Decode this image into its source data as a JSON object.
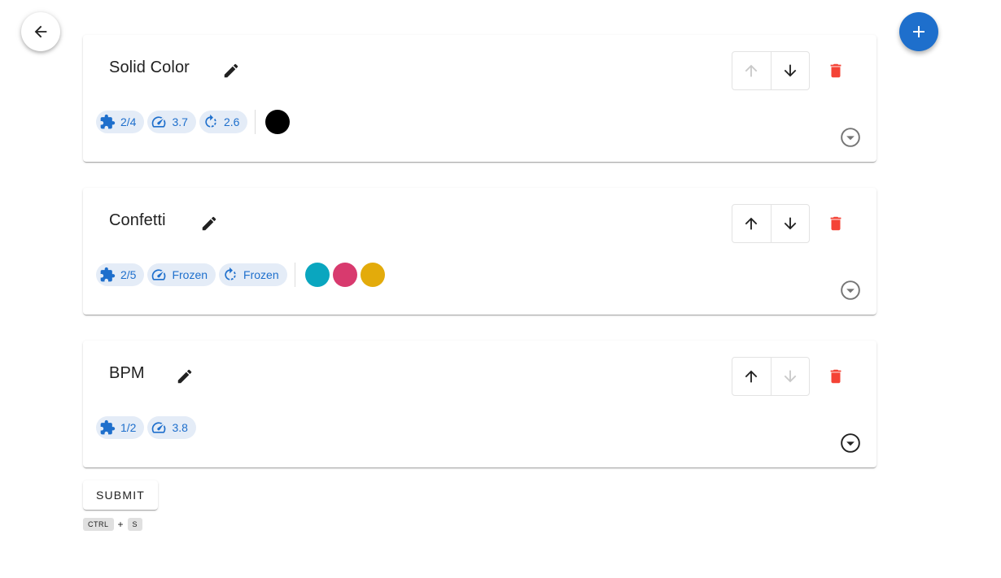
{
  "buttons": {
    "back_icon": "arrow-left-icon",
    "add_icon": "plus-icon",
    "submit_label": "SUBMIT"
  },
  "shortcut": {
    "key1": "CTRL",
    "plus": "+",
    "key2": "S"
  },
  "colors": {
    "accent": "#1e6fcc",
    "delete": "#f44336",
    "chip_bg": "#e4ecf7"
  },
  "effects": [
    {
      "title": "Solid Color",
      "chips": [
        {
          "icon": "puzzle-icon",
          "value": "2/4"
        },
        {
          "icon": "speed-icon",
          "value": "3.7"
        },
        {
          "icon": "rotate-icon",
          "value": "2.6"
        }
      ],
      "colors": [
        "#000000"
      ],
      "move_up_enabled": false,
      "move_down_enabled": true
    },
    {
      "title": "Confetti",
      "chips": [
        {
          "icon": "puzzle-icon",
          "value": "2/5"
        },
        {
          "icon": "speed-icon",
          "value": "Frozen"
        },
        {
          "icon": "rotate-icon",
          "value": "Frozen"
        }
      ],
      "colors": [
        "#0aa6bf",
        "#d83a6e",
        "#e3ab0b"
      ],
      "move_up_enabled": true,
      "move_down_enabled": true
    },
    {
      "title": "BPM",
      "chips": [
        {
          "icon": "puzzle-icon",
          "value": "1/2"
        },
        {
          "icon": "speed-icon",
          "value": "3.8"
        }
      ],
      "colors": [],
      "move_up_enabled": true,
      "move_down_enabled": false
    }
  ]
}
